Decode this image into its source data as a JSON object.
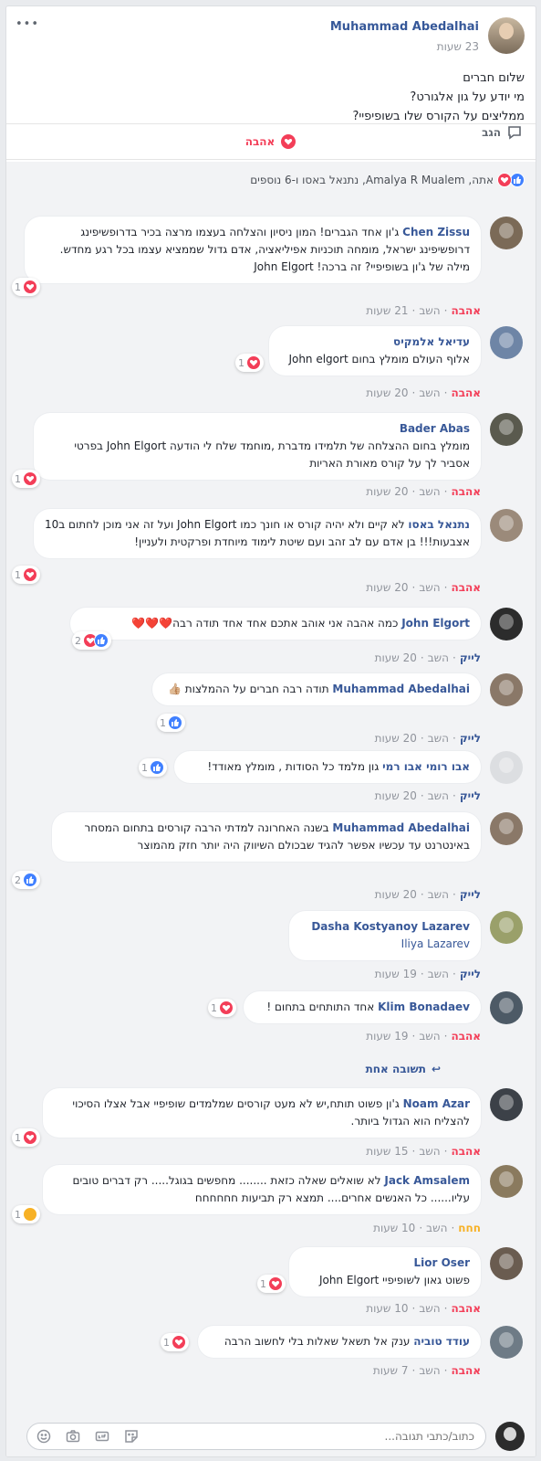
{
  "post": {
    "menu": "•••",
    "author": "Muhammad Abedalhai",
    "time": "23 שעות",
    "lines": [
      "שלום חברים",
      "מי יודע על גון אלגורט?",
      "ממליצים על הקורס שלו בשופיפיי?"
    ],
    "love_label": "אהבה",
    "comment_label": "הגב"
  },
  "reactions_summary": "אתה, Amalya R Mualem, נתנאל באסו ו-6 נוספים",
  "comments": [
    {
      "name": "Chen Zissu",
      "text": "ג'ון אחד הגברים! המון ניסיון והצלחה בעצמו מרצה בכיר בדרופשיפינג דרופשיפינג ישראל, מומחה תוכניות אפיליאציה, אדם גדול שממציא עצמו בכל רגע מחדש. מילה של ג'ון בשופיפיי? זה ברכה! John Elgort",
      "count": "1",
      "react": "אהבה",
      "reply": "השב",
      "time": "21 שעות"
    },
    {
      "name": "עדיאל אלמקיס",
      "text": "אלוף העולם מומלץ בחום John elgort",
      "count": "1",
      "react": "אהבה",
      "reply": "השב",
      "time": "20 שעות"
    },
    {
      "name": "Bader Abas",
      "text": "מומלץ בחום ההצלחה של תלמידו מדברת ,מוחמד שלח לי הודעה John Elgort בפרטי אסביר לך על קורס מאורת האריות",
      "count": "1",
      "react": "אהבה",
      "reply": "השב",
      "time": "20 שעות"
    },
    {
      "name": "נתנאל באסו",
      "text": "לא קיים ולא יהיה קורס או חונך כמו John Elgort ועל זה אני מוכן לחתום ב10 אצבעות!!! בן אדם עם לב זהב ועם שיטת לימוד מיוחדת ופרקטית ולעניין!",
      "count": "1",
      "react": "אהבה",
      "reply": "השב",
      "time": "20 שעות"
    },
    {
      "name": "John Elgort",
      "text": "כמה אהבה אני אוהב אתכם אחד אחד תודה רבה❤️❤️❤️",
      "count": "2",
      "react": "לייק",
      "reply": "השב",
      "time": "20 שעות"
    },
    {
      "name": "Muhammad Abedalhai",
      "text": "תודה רבה חברים על ההמלצות 👍🏼",
      "count": "1",
      "react": "לייק",
      "reply": "השב",
      "time": "20 שעות"
    },
    {
      "name": "אבו רומי אבו רמי",
      "text": "גון מלמד כל הסודות , מומלץ מאודד!",
      "count": "1",
      "react": "לייק",
      "reply": "השב",
      "time": "20 שעות"
    },
    {
      "name": "Muhammad Abedalhai",
      "text": "בשנה האחרונה למדתי הרבה קורסים בתחום המסחר באינטרנט עד עכשיו אפשר להגיד שבכולם השיווק היה יותר חזק מהמוצר",
      "count": "2",
      "react": "לייק",
      "reply": "השב",
      "time": "20 שעות"
    },
    {
      "name": "Dasha Kostyanoy Lazarev",
      "text": "Iliya Lazarev",
      "count": "",
      "react": "לייק",
      "reply": "השב",
      "time": "19 שעות"
    },
    {
      "name": "Klim Bonadaev",
      "text": "אחד התותחים בתחום !",
      "count": "1",
      "react": "אהבה",
      "reply": "השב",
      "time": "19 שעות"
    },
    {
      "name": "Noam Azar",
      "text": "ג'ון פשוט תותח,יש לא מעט קורסים שמלמדים שופיפיי אבל אצלו הסיכוי להצליח הוא הגדול ביותר.",
      "count": "1",
      "react": "אהבה",
      "reply": "השב",
      "time": "15 שעות"
    },
    {
      "name": "Jack Amsalem",
      "text": "לא שואלים שאלה כזאת ........ מחפשים בגוגל..... רק דברים טובים עליו...... כל האנשים אחרים.... תמצא רק תביעות חחחחחח",
      "count": "1",
      "react": "חחח",
      "reply": "השב",
      "time": "10 שעות"
    },
    {
      "name": "Lior Oser",
      "text": "פשוט גאון לשופיפיי John Elgort",
      "count": "1",
      "react": "אהבה",
      "reply": "השב",
      "time": "10 שעות"
    },
    {
      "name": "עודד טוביה",
      "text": "ענק אל תשאל שאלות בלי לחשוב הרבה",
      "count": "1",
      "react": "אהבה",
      "reply": "השב",
      "time": "7 שעות"
    }
  ],
  "replies_link": "תשובה אחת",
  "composer": {
    "placeholder": "כתוב/כתבי תגובה..."
  },
  "colors": {
    "love": "#f33e58",
    "like": "#4080ff",
    "link": "#385898",
    "bg": "#f2f3f5"
  }
}
